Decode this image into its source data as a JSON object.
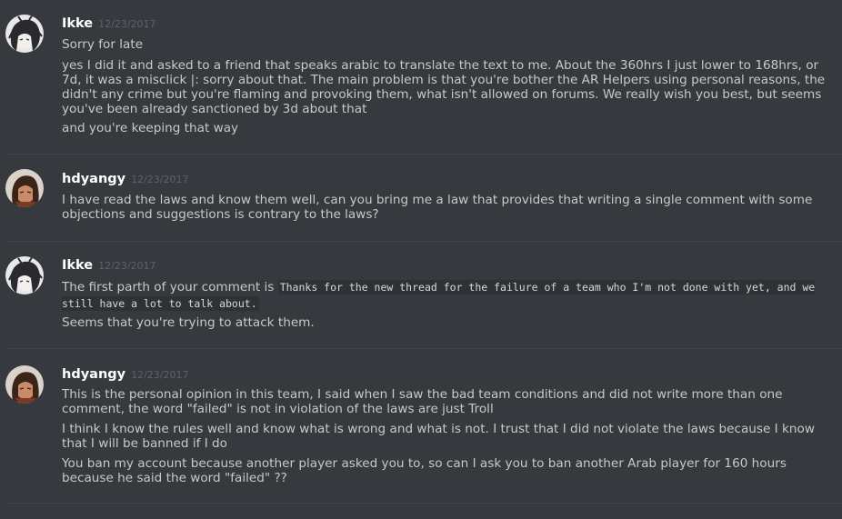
{
  "messages": [
    {
      "username": "Ikke",
      "timestamp": "12/23/2017",
      "avatar": "anime-avatar-dark-hair-icon",
      "lines": [
        "Sorry for late",
        "yes I did it and asked to a friend that speaks arabic to translate the text to me. About the 360hrs I just lower to 168hrs, or 7d, it was a misclick |: sorry about that. The main problem is that you're bother the AR Helpers using personal reasons, the didn't any crime but you're flaming and provoking them, what isn't allowed on forums. We really wish you best, but seems you've been already sanctioned by 3d about that",
        "and you're keeping that way"
      ]
    },
    {
      "username": "hdyangy",
      "timestamp": "12/23/2017",
      "avatar": "character-avatar-brown-hair-icon",
      "lines": [
        "I have read the laws and know them well, can you bring me a law that provides that writing a single comment with some objections and suggestions is contrary to the laws?"
      ]
    },
    {
      "username": "Ikke",
      "timestamp": "12/23/2017",
      "avatar": "anime-avatar-dark-hair-icon",
      "line1_prefix": "The first parth of your comment is ",
      "line1_code": "Thanks for the new thread for the failure of a team who I'm not done with yet, and we still have a lot to talk about.",
      "line2": "Seems that you're trying to attack them."
    },
    {
      "username": "hdyangy",
      "timestamp": "12/23/2017",
      "avatar": "character-avatar-brown-hair-icon",
      "lines": [
        "This is the personal opinion in this team, I said when I saw the bad team conditions and did not write more than one comment, the word \"failed\" is not in violation of the laws are just Troll",
        "I think I know the rules well and know what is wrong and what is not. I trust that I did not violate the laws because I know that I will be banned if I do",
        "You ban my account because another player asked you to, so can I ask you to ban another Arab player for 160 hours because he said the word \"failed\" ??"
      ]
    }
  ]
}
